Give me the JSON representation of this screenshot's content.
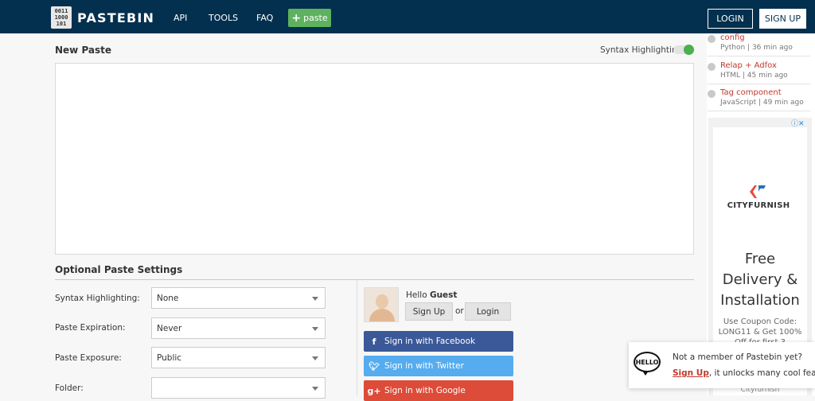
{
  "header": {
    "logo_mark": "0011 1000 101",
    "brand": "PASTEBIN",
    "nav": [
      "API",
      "TOOLS",
      "FAQ"
    ],
    "paste_button": "paste",
    "login": "LOGIN",
    "signup": "SIGN UP"
  },
  "editor": {
    "title": "New Paste",
    "syntax_highlighting_label": "Syntax Highlighting",
    "syntax_highlighting_enabled": true
  },
  "options": {
    "title": "Optional Paste Settings",
    "fields": [
      {
        "label": "Syntax Highlighting:",
        "value": "None"
      },
      {
        "label": "Paste Expiration:",
        "value": "Never"
      },
      {
        "label": "Paste Exposure:",
        "value": "Public"
      },
      {
        "label": "Folder:",
        "value": ""
      }
    ]
  },
  "account": {
    "hello": "Hello",
    "user": "Guest",
    "signup": "Sign Up",
    "or": "or",
    "login": "Login",
    "facebook": "Sign in with Facebook",
    "twitter": "Sign in with Twitter",
    "google": "Sign in with Google"
  },
  "recent_pastes": [
    {
      "title": "config",
      "meta": "Python | 36 min ago"
    },
    {
      "title": "Relap + Adfox",
      "meta": "HTML | 45 min ago"
    },
    {
      "title": "Tag component",
      "meta": "JavaScript | 49 min ago"
    }
  ],
  "ad": {
    "brand": "CITYFURNISH",
    "headline": "Free Delivery & Installation",
    "sub": "Use Coupon Code: LONG11 & Get 100% Off for first 3",
    "footer": "Cityfurnish",
    "brand_color": "#e84b3c"
  },
  "popup": {
    "bubble": "HELLO",
    "line1": "Not a member of Pastebin yet?",
    "signup": "Sign Up",
    "line2_rest": ", it unlocks many cool features!"
  },
  "colors": {
    "header": "#03304f",
    "accent_green": "#5eb15e",
    "facebook": "#3b5998",
    "twitter": "#55acee",
    "google": "#dd4b39"
  }
}
